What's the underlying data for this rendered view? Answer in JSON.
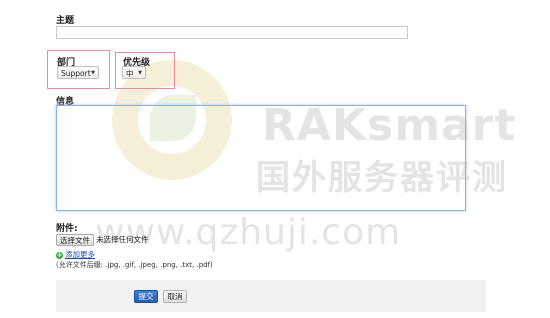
{
  "form": {
    "subject_label": "主题",
    "subject_value": "",
    "department_label": "部门",
    "department_value": "Support",
    "priority_label": "优先级",
    "priority_value": "中",
    "message_label": "信息",
    "attachments_label": "附件:",
    "choose_file_label": "选择文件",
    "no_file_text": "未选择任何文件",
    "add_more_label": "添加更多",
    "allowed_ext_text": "(允许文件后缀: .jpg, .gif, .jpeg, .png, .txt, .pdf)",
    "submit_label": "提交",
    "cancel_label": "取消"
  },
  "watermark": {
    "brand": "RAKsmart",
    "subtitle": "国外服务器评测",
    "url": "www.qzhuji.com"
  },
  "icons": {
    "add_more": "plus-circle-icon",
    "dropdown": "chevron-down-icon"
  },
  "colors": {
    "highlight_box": "#f08a9a",
    "submit_button": "#2f6fc4",
    "textarea_focus": "#8ab4de",
    "add_icon": "#3bab3b"
  }
}
